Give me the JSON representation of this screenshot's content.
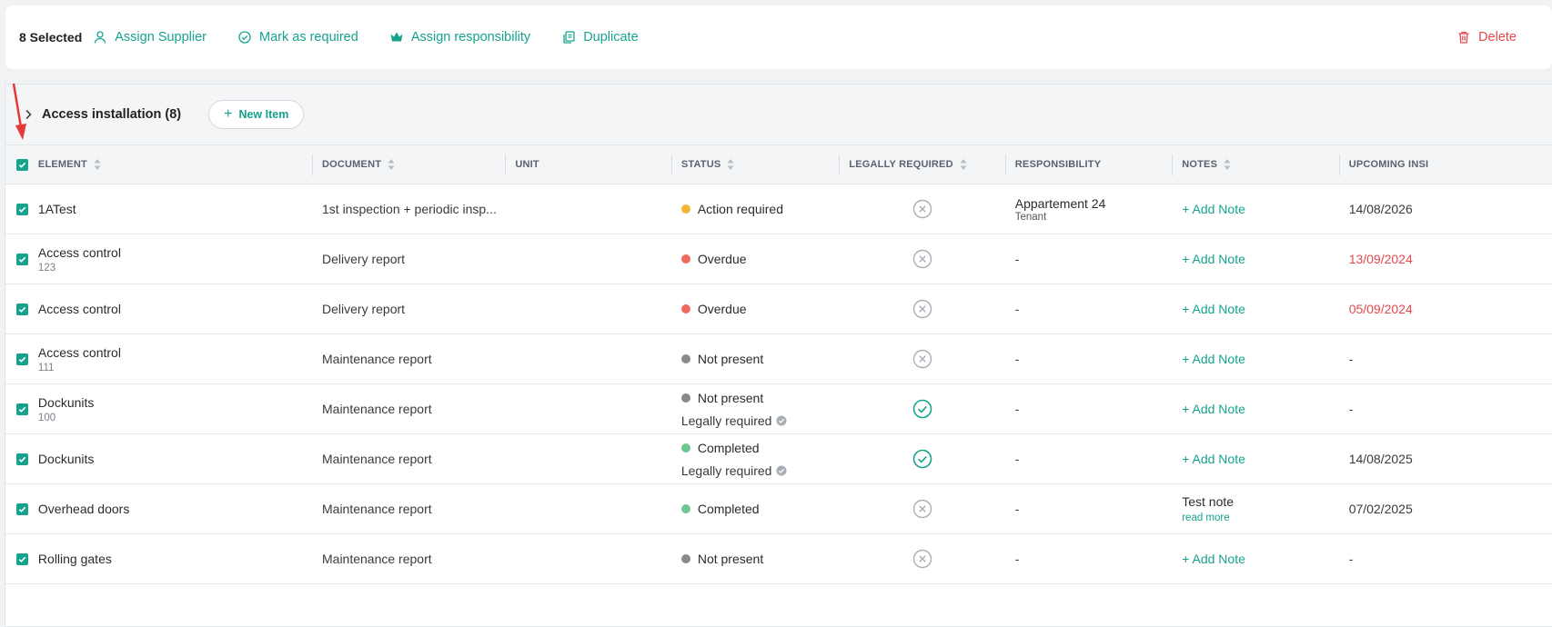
{
  "toolbar": {
    "selected_label": "8 Selected",
    "assign_supplier": "Assign Supplier",
    "mark_required": "Mark as required",
    "assign_responsibility": "Assign responsibility",
    "duplicate": "Duplicate",
    "delete": "Delete"
  },
  "group": {
    "title": "Access installation (8)",
    "new_item": "New Item"
  },
  "columns": {
    "element": "ELEMENT",
    "document": "DOCUMENT",
    "unit": "UNIT",
    "status": "STATUS",
    "legally_required": "LEGALLY REQUIRED",
    "responsibility": "RESPONSIBILITY",
    "notes": "NOTES",
    "upcoming": "UPCOMING INSI"
  },
  "rows": [
    {
      "name": "1ATest",
      "sub": "",
      "document": "1st inspection + periodic insp...",
      "unit": "",
      "status": "Action required",
      "status_color": "#f5b731",
      "legal_tag": "",
      "legally_required": false,
      "resp": "Appartement 24",
      "resp_sub": "Tenant",
      "note": "+ Add Note",
      "read_more": "",
      "date": "14/08/2026",
      "date_overdue": false
    },
    {
      "name": "Access control",
      "sub": "123",
      "document": "Delivery report",
      "unit": "",
      "status": "Overdue",
      "status_color": "#ef6a5b",
      "legal_tag": "",
      "legally_required": false,
      "resp": "-",
      "resp_sub": "",
      "note": "+ Add Note",
      "read_more": "",
      "date": "13/09/2024",
      "date_overdue": true
    },
    {
      "name": "Access control",
      "sub": "",
      "document": "Delivery report",
      "unit": "",
      "status": "Overdue",
      "status_color": "#ef6a5b",
      "legal_tag": "",
      "legally_required": false,
      "resp": "-",
      "resp_sub": "",
      "note": "+ Add Note",
      "read_more": "",
      "date": "05/09/2024",
      "date_overdue": true
    },
    {
      "name": "Access control",
      "sub": "111",
      "document": "Maintenance report",
      "unit": "",
      "status": "Not present",
      "status_color": "#8a8a8a",
      "legal_tag": "",
      "legally_required": false,
      "resp": "-",
      "resp_sub": "",
      "note": "+ Add Note",
      "read_more": "",
      "date": "-",
      "date_overdue": false
    },
    {
      "name": "Dockunits",
      "sub": "100",
      "document": "Maintenance report",
      "unit": "",
      "status": "Not present",
      "status_color": "#8a8a8a",
      "legal_tag": "Legally required",
      "legally_required": true,
      "resp": "-",
      "resp_sub": "",
      "note": "+ Add Note",
      "read_more": "",
      "date": "-",
      "date_overdue": false
    },
    {
      "name": "Dockunits",
      "sub": "",
      "document": "Maintenance report",
      "unit": "",
      "status": "Completed",
      "status_color": "#6cc790",
      "legal_tag": "Legally required",
      "legally_required": true,
      "resp": "-",
      "resp_sub": "",
      "note": "+ Add Note",
      "read_more": "",
      "date": "14/08/2025",
      "date_overdue": false
    },
    {
      "name": "Overhead doors",
      "sub": "",
      "document": "Maintenance report",
      "unit": "",
      "status": "Completed",
      "status_color": "#6cc790",
      "legal_tag": "",
      "legally_required": false,
      "resp": "-",
      "resp_sub": "",
      "note": "Test note",
      "read_more": "read more",
      "date": "07/02/2025",
      "date_overdue": false
    },
    {
      "name": "Rolling gates",
      "sub": "",
      "document": "Maintenance report",
      "unit": "",
      "status": "Not present",
      "status_color": "#8a8a8a",
      "legal_tag": "",
      "legally_required": false,
      "resp": "-",
      "resp_sub": "",
      "note": "+ Add Note",
      "read_more": "",
      "date": "-",
      "date_overdue": false
    }
  ]
}
